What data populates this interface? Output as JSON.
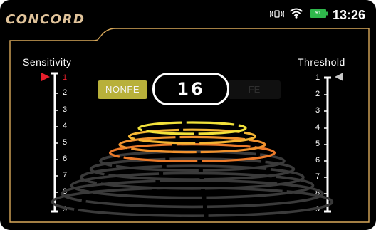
{
  "header": {
    "brand": "CONCORD",
    "time": "13:26",
    "battery_level": "91",
    "icons": [
      "vibrate-icon",
      "wifi-icon",
      "battery-icon"
    ]
  },
  "sensitivity": {
    "title": "Sensitivity",
    "levels": [
      "1",
      "2",
      "3",
      "4",
      "5",
      "6",
      "7",
      "8",
      "9"
    ],
    "selected": "1"
  },
  "threshold": {
    "title": "Threshold",
    "levels": [
      "1",
      "2",
      "3",
      "4",
      "5",
      "6",
      "7",
      "8",
      "9"
    ],
    "selected": "1"
  },
  "mode": {
    "nonfe_label": "NONFE",
    "fe_label": "FE",
    "active": "NONFE",
    "value": "16"
  },
  "signal_graph": {
    "rings_total": 10,
    "rings_active": 4
  },
  "colors": {
    "frame": "#d9a95a",
    "brand": "#e0c39a",
    "selected_marker": "#e81f2c",
    "nonfe_bg": "#b8b03a",
    "battery": "#2fb84c",
    "ring_colors": [
      "#f2e23b",
      "#f4b534",
      "#f0922e",
      "#ec7a2a"
    ],
    "ring_inactive": "#3a3a3a"
  }
}
